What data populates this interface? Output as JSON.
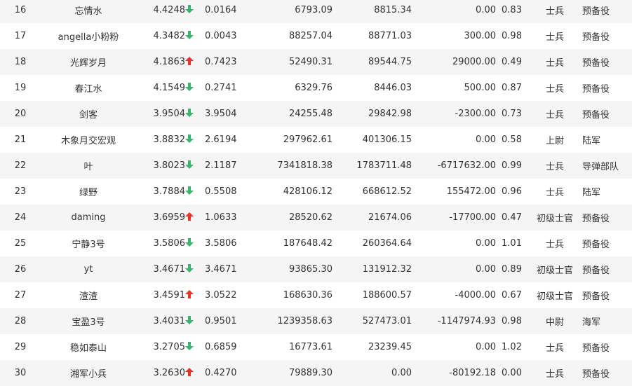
{
  "colors": {
    "up": "#e8332a",
    "down": "#3cb371",
    "row_alt": "#f5f5f5"
  },
  "rows": [
    {
      "rank": "16",
      "name": "忘情水",
      "score": "4.4248",
      "trend": "down",
      "rate": "0.0164",
      "v1": "6793.09",
      "v2": "8815.34",
      "v3": "0.00",
      "ratio": "0.83",
      "title": "士兵",
      "unit": "预备役"
    },
    {
      "rank": "17",
      "name": "angella小粉粉",
      "score": "4.3482",
      "trend": "down",
      "rate": "0.0043",
      "v1": "88257.04",
      "v2": "88771.03",
      "v3": "300.00",
      "ratio": "0.98",
      "title": "士兵",
      "unit": "预备役"
    },
    {
      "rank": "18",
      "name": "光辉岁月",
      "score": "4.1863",
      "trend": "up",
      "rate": "0.7423",
      "v1": "52490.31",
      "v2": "89544.75",
      "v3": "29000.00",
      "ratio": "0.49",
      "title": "士兵",
      "unit": "预备役"
    },
    {
      "rank": "19",
      "name": "春江水",
      "score": "4.1549",
      "trend": "down",
      "rate": "0.2741",
      "v1": "6329.76",
      "v2": "8446.03",
      "v3": "500.00",
      "ratio": "0.87",
      "title": "士兵",
      "unit": "预备役"
    },
    {
      "rank": "20",
      "name": "剑客",
      "score": "3.9504",
      "trend": "down",
      "rate": "3.9504",
      "v1": "24255.48",
      "v2": "29842.98",
      "v3": "-2300.00",
      "ratio": "0.73",
      "title": "士兵",
      "unit": "预备役"
    },
    {
      "rank": "21",
      "name": "木象月交宏观",
      "score": "3.8832",
      "trend": "down",
      "rate": "2.6194",
      "v1": "297962.61",
      "v2": "401306.15",
      "v3": "0.00",
      "ratio": "0.58",
      "title": "上尉",
      "unit": "陆军"
    },
    {
      "rank": "22",
      "name": "叶",
      "score": "3.8023",
      "trend": "down",
      "rate": "2.1187",
      "v1": "7341818.38",
      "v2": "1783711.48",
      "v3": "-6717632.00",
      "ratio": "0.99",
      "title": "士兵",
      "unit": "导弹部队"
    },
    {
      "rank": "23",
      "name": "绿野",
      "score": "3.7884",
      "trend": "down",
      "rate": "0.5508",
      "v1": "428106.12",
      "v2": "668612.52",
      "v3": "155472.00",
      "ratio": "0.96",
      "title": "士兵",
      "unit": "陆军"
    },
    {
      "rank": "24",
      "name": "daming",
      "score": "3.6959",
      "trend": "up",
      "rate": "1.0633",
      "v1": "28520.62",
      "v2": "21674.06",
      "v3": "-17700.00",
      "ratio": "0.47",
      "title": "初级士官",
      "unit": "预备役"
    },
    {
      "rank": "25",
      "name": "宁静3号",
      "score": "3.5806",
      "trend": "down",
      "rate": "3.5806",
      "v1": "187648.42",
      "v2": "260364.64",
      "v3": "0.00",
      "ratio": "1.01",
      "title": "士兵",
      "unit": "预备役"
    },
    {
      "rank": "26",
      "name": "yt",
      "score": "3.4671",
      "trend": "down",
      "rate": "3.4671",
      "v1": "93865.30",
      "v2": "131912.32",
      "v3": "0.00",
      "ratio": "0.89",
      "title": "初级士官",
      "unit": "预备役"
    },
    {
      "rank": "27",
      "name": "渣渣",
      "score": "3.4591",
      "trend": "up",
      "rate": "3.0522",
      "v1": "168630.36",
      "v2": "188600.57",
      "v3": "-4000.00",
      "ratio": "0.67",
      "title": "初级士官",
      "unit": "预备役"
    },
    {
      "rank": "28",
      "name": "宝盈3号",
      "score": "3.4031",
      "trend": "down",
      "rate": "0.9501",
      "v1": "1239358.63",
      "v2": "527473.01",
      "v3": "-1147974.93",
      "ratio": "0.98",
      "title": "中尉",
      "unit": "海军"
    },
    {
      "rank": "29",
      "name": "稳如泰山",
      "score": "3.2705",
      "trend": "down",
      "rate": "0.6859",
      "v1": "16773.61",
      "v2": "23239.45",
      "v3": "0.00",
      "ratio": "1.02",
      "title": "士兵",
      "unit": "预备役"
    },
    {
      "rank": "30",
      "name": "湘军小兵",
      "score": "3.2630",
      "trend": "up",
      "rate": "0.4270",
      "v1": "79889.30",
      "v2": "0.00",
      "v3": "-80192.18",
      "ratio": "0.00",
      "title": "士兵",
      "unit": "预备役"
    }
  ]
}
